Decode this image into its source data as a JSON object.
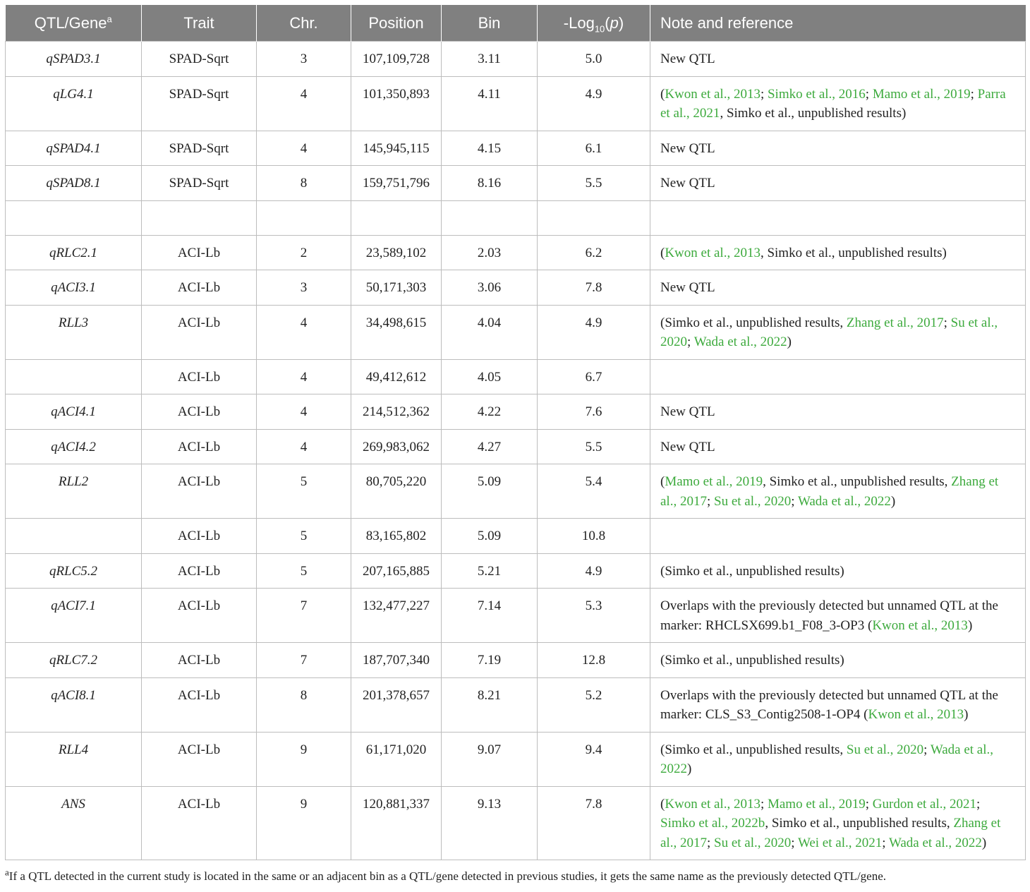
{
  "header": {
    "qtl": "QTL/Gene",
    "qtl_sup": "a",
    "trait": "Trait",
    "chr": "Chr.",
    "position": "Position",
    "bin": "Bin",
    "logp_prefix": "-Log",
    "logp_sub": "10",
    "logp_open": "(",
    "logp_var": "p",
    "logp_close": ")",
    "note": "Note and reference"
  },
  "rows": [
    {
      "qtl": "qSPAD3.1",
      "trait": "SPAD-Sqrt",
      "chr": "3",
      "position": "107,109,728",
      "bin": "3.11",
      "logp": "5.0",
      "note": [
        {
          "t": "New QTL"
        }
      ]
    },
    {
      "qtl": "qLG4.1",
      "trait": "SPAD-Sqrt",
      "chr": "4",
      "position": "101,350,893",
      "bin": "4.11",
      "logp": "4.9",
      "note": [
        {
          "t": "("
        },
        {
          "t": "Kwon et al., 2013",
          "ref": true
        },
        {
          "t": "; "
        },
        {
          "t": "Simko et al., 2016",
          "ref": true
        },
        {
          "t": "; "
        },
        {
          "t": "Mamo et al., 2019",
          "ref": true
        },
        {
          "t": "; "
        },
        {
          "t": "Parra et al., 2021",
          "ref": true
        },
        {
          "t": ", Simko et al., unpublished results)"
        }
      ]
    },
    {
      "qtl": "qSPAD4.1",
      "trait": "SPAD-Sqrt",
      "chr": "4",
      "position": "145,945,115",
      "bin": "4.15",
      "logp": "6.1",
      "note": [
        {
          "t": "New QTL"
        }
      ]
    },
    {
      "qtl": "qSPAD8.1",
      "trait": "SPAD-Sqrt",
      "chr": "8",
      "position": "159,751,796",
      "bin": "8.16",
      "logp": "5.5",
      "note": [
        {
          "t": "New QTL"
        }
      ]
    },
    {
      "qtl": "",
      "trait": "",
      "chr": "",
      "position": "",
      "bin": "",
      "logp": "",
      "note": []
    },
    {
      "qtl": "qRLC2.1",
      "trait": "ACI-Lb",
      "chr": "2",
      "position": "23,589,102",
      "bin": "2.03",
      "logp": "6.2",
      "note": [
        {
          "t": "("
        },
        {
          "t": "Kwon et al., 2013",
          "ref": true
        },
        {
          "t": ", Simko et al., unpublished results)"
        }
      ]
    },
    {
      "qtl": "qACI3.1",
      "trait": "ACI-Lb",
      "chr": "3",
      "position": "50,171,303",
      "bin": "3.06",
      "logp": "7.8",
      "note": [
        {
          "t": "New QTL"
        }
      ]
    },
    {
      "qtl": "RLL3",
      "trait": "ACI-Lb",
      "chr": "4",
      "position": "34,498,615",
      "bin": "4.04",
      "logp": "4.9",
      "note": [
        {
          "t": "(Simko et al., unpublished results, "
        },
        {
          "t": "Zhang et al., 2017",
          "ref": true
        },
        {
          "t": "; "
        },
        {
          "t": "Su et al., 2020",
          "ref": true
        },
        {
          "t": "; "
        },
        {
          "t": "Wada et al., 2022",
          "ref": true
        },
        {
          "t": ")"
        }
      ]
    },
    {
      "qtl": "",
      "trait": "ACI-Lb",
      "chr": "4",
      "position": "49,412,612",
      "bin": "4.05",
      "logp": "6.7",
      "note": []
    },
    {
      "qtl": "qACI4.1",
      "trait": "ACI-Lb",
      "chr": "4",
      "position": "214,512,362",
      "bin": "4.22",
      "logp": "7.6",
      "note": [
        {
          "t": "New QTL"
        }
      ]
    },
    {
      "qtl": "qACI4.2",
      "trait": "ACI-Lb",
      "chr": "4",
      "position": "269,983,062",
      "bin": "4.27",
      "logp": "5.5",
      "note": [
        {
          "t": "New QTL"
        }
      ]
    },
    {
      "qtl": "RLL2",
      "trait": "ACI-Lb",
      "chr": "5",
      "position": "80,705,220",
      "bin": "5.09",
      "logp": "5.4",
      "note": [
        {
          "t": "("
        },
        {
          "t": "Mamo et al., 2019",
          "ref": true
        },
        {
          "t": ", Simko et al., unpublished results, "
        },
        {
          "t": "Zhang et al., 2017",
          "ref": true
        },
        {
          "t": "; "
        },
        {
          "t": "Su et al., 2020",
          "ref": true
        },
        {
          "t": "; "
        },
        {
          "t": "Wada et al., 2022",
          "ref": true
        },
        {
          "t": ")"
        }
      ]
    },
    {
      "qtl": "",
      "trait": "ACI-Lb",
      "chr": "5",
      "position": "83,165,802",
      "bin": "5.09",
      "logp": "10.8",
      "note": []
    },
    {
      "qtl": "qRLC5.2",
      "trait": "ACI-Lb",
      "chr": "5",
      "position": "207,165,885",
      "bin": "5.21",
      "logp": "4.9",
      "note": [
        {
          "t": "(Simko et al., unpublished results)"
        }
      ]
    },
    {
      "qtl": "qACI7.1",
      "trait": "ACI-Lb",
      "chr": "7",
      "position": "132,477,227",
      "bin": "7.14",
      "logp": "5.3",
      "note": [
        {
          "t": "Overlaps with the previously detected but unnamed QTL at the marker: RHCLSX699.b1_F08_3-OP3 ("
        },
        {
          "t": "Kwon et al., 2013",
          "ref": true
        },
        {
          "t": ")"
        }
      ]
    },
    {
      "qtl": "qRLC7.2",
      "trait": "ACI-Lb",
      "chr": "7",
      "position": "187,707,340",
      "bin": "7.19",
      "logp": "12.8",
      "note": [
        {
          "t": "(Simko et al., unpublished results)"
        }
      ]
    },
    {
      "qtl": "qACI8.1",
      "trait": "ACI-Lb",
      "chr": "8",
      "position": "201,378,657",
      "bin": "8.21",
      "logp": "5.2",
      "note": [
        {
          "t": "Overlaps with the previously detected but unnamed QTL at the marker: CLS_S3_Contig2508-1-OP4 ("
        },
        {
          "t": "Kwon et al., 2013",
          "ref": true
        },
        {
          "t": ")"
        }
      ]
    },
    {
      "qtl": "RLL4",
      "trait": "ACI-Lb",
      "chr": "9",
      "position": "61,171,020",
      "bin": "9.07",
      "logp": "9.4",
      "note": [
        {
          "t": "(Simko et al., unpublished results, "
        },
        {
          "t": "Su et al., 2020",
          "ref": true
        },
        {
          "t": "; "
        },
        {
          "t": "Wada et al., 2022",
          "ref": true
        },
        {
          "t": ")"
        }
      ]
    },
    {
      "qtl": "ANS",
      "trait": "ACI-Lb",
      "chr": "9",
      "position": "120,881,337",
      "bin": "9.13",
      "logp": "7.8",
      "note": [
        {
          "t": "("
        },
        {
          "t": "Kwon et al., 2013",
          "ref": true
        },
        {
          "t": "; "
        },
        {
          "t": "Mamo et al., 2019",
          "ref": true
        },
        {
          "t": "; "
        },
        {
          "t": "Gurdon et al., 2021",
          "ref": true
        },
        {
          "t": "; "
        },
        {
          "t": "Simko et al., 2022b",
          "ref": true
        },
        {
          "t": ", Simko et al., unpublished results, "
        },
        {
          "t": "Zhang et al., 2017",
          "ref": true
        },
        {
          "t": "; "
        },
        {
          "t": "Su et al., 2020",
          "ref": true
        },
        {
          "t": "; "
        },
        {
          "t": "Wei et al., 2021",
          "ref": true
        },
        {
          "t": "; "
        },
        {
          "t": "Wada et al., 2022",
          "ref": true
        },
        {
          "t": ")"
        }
      ]
    }
  ],
  "footnote": {
    "sup": "a",
    "text": "If a QTL detected in the current study is located in the same or an adjacent bin as a QTL/gene detected in previous studies, it gets the same name as the previously detected QTL/gene."
  },
  "colors": {
    "header_bg": "#808080",
    "reference_link": "#3daa3d"
  }
}
